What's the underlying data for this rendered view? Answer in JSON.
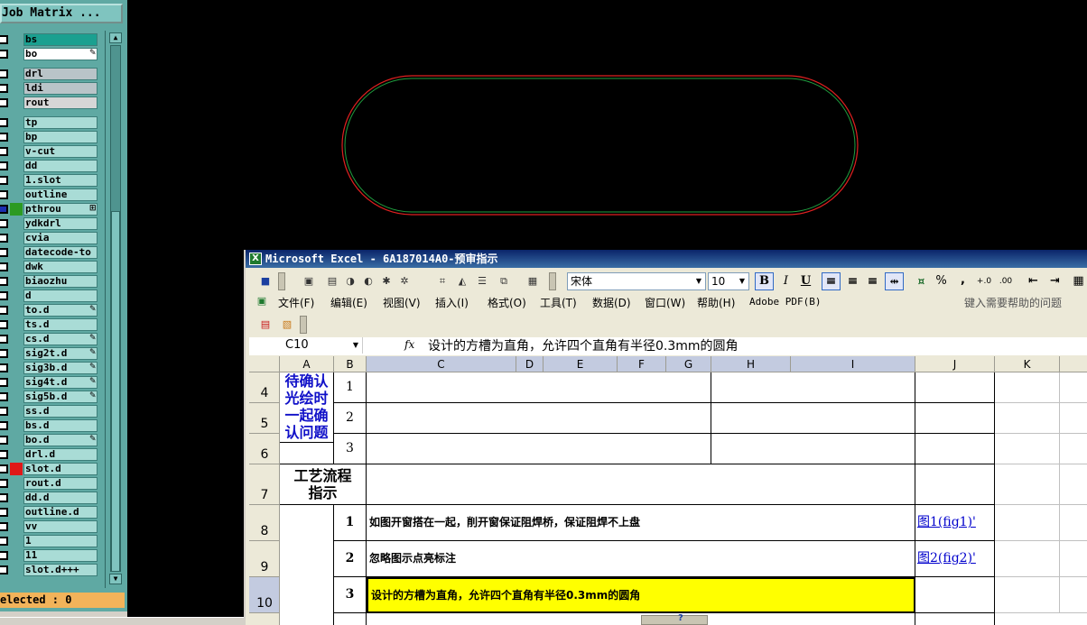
{
  "job_matrix": {
    "title": "Job Matrix ...",
    "layers": [
      {
        "name": "bs",
        "highlight": "#1aa090",
        "swatch": ""
      },
      {
        "name": "bo",
        "highlight": "#ffffff",
        "swatch": "",
        "mark": "✎"
      },
      {
        "name": "drl",
        "highlight": "#b9c4c8",
        "swatch": ""
      },
      {
        "name": "ldi",
        "highlight": "#b9c4c8",
        "swatch": ""
      },
      {
        "name": "rout",
        "highlight": "#d6d6d6",
        "swatch": ""
      },
      {
        "name": "tp",
        "highlight": "",
        "swatch": ""
      },
      {
        "name": "bp",
        "highlight": "",
        "swatch": ""
      },
      {
        "name": "v-cut",
        "highlight": "",
        "swatch": ""
      },
      {
        "name": "dd",
        "highlight": "",
        "swatch": ""
      },
      {
        "name": "1.slot",
        "highlight": "",
        "swatch": ""
      },
      {
        "name": "outline",
        "highlight": "",
        "swatch": ""
      },
      {
        "name": "pthrou",
        "highlight": "",
        "swatch": "#2c9a22",
        "mark": "⊞",
        "chk_color": "#1b2fb0"
      },
      {
        "name": "ydkdrl",
        "highlight": "",
        "swatch": ""
      },
      {
        "name": "cvia",
        "highlight": "",
        "swatch": ""
      },
      {
        "name": "datecode-to",
        "highlight": "",
        "swatch": ""
      },
      {
        "name": "dwk",
        "highlight": "",
        "swatch": ""
      },
      {
        "name": "biaozhu",
        "highlight": "",
        "swatch": ""
      },
      {
        "name": "d",
        "highlight": "",
        "swatch": ""
      },
      {
        "name": "to.d",
        "highlight": "",
        "swatch": "",
        "mark": "✎"
      },
      {
        "name": "ts.d",
        "highlight": "",
        "swatch": ""
      },
      {
        "name": "cs.d",
        "highlight": "",
        "swatch": "",
        "mark": "✎"
      },
      {
        "name": "sig2t.d",
        "highlight": "",
        "swatch": "",
        "mark": "✎"
      },
      {
        "name": "sig3b.d",
        "highlight": "",
        "swatch": "",
        "mark": "✎"
      },
      {
        "name": "sig4t.d",
        "highlight": "",
        "swatch": "",
        "mark": "✎"
      },
      {
        "name": "sig5b.d",
        "highlight": "",
        "swatch": "",
        "mark": "✎"
      },
      {
        "name": "ss.d",
        "highlight": "",
        "swatch": ""
      },
      {
        "name": "bs.d",
        "highlight": "",
        "swatch": ""
      },
      {
        "name": "bo.d",
        "highlight": "",
        "swatch": "",
        "mark": "✎"
      },
      {
        "name": "drl.d",
        "highlight": "",
        "swatch": ""
      },
      {
        "name": "slot.d",
        "highlight": "",
        "swatch": "#e01818"
      },
      {
        "name": "rout.d",
        "highlight": "",
        "swatch": ""
      },
      {
        "name": "dd.d",
        "highlight": "",
        "swatch": ""
      },
      {
        "name": "outline.d",
        "highlight": "",
        "swatch": ""
      },
      {
        "name": "vv",
        "highlight": "",
        "swatch": ""
      },
      {
        "name": "1",
        "highlight": "",
        "swatch": ""
      },
      {
        "name": "11",
        "highlight": "",
        "swatch": ""
      },
      {
        "name": "slot.d+++",
        "highlight": "",
        "swatch": ""
      }
    ],
    "status": "elected : 0"
  },
  "drawing": {
    "outer_color": "#e02020",
    "inner_color": "#20a040"
  },
  "excel": {
    "title": "Microsoft Excel - 6A187014A0-预审指示",
    "font_name": "宋体",
    "font_size": "10",
    "format_buttons": {
      "bold": "B",
      "italic": "I",
      "underline": "U"
    },
    "number_buttons": [
      "%",
      ",",
      "+.0",
      ".00"
    ],
    "menu": [
      "文件(F)",
      "编辑(E)",
      "视图(V)",
      "插入(I)",
      "格式(O)",
      "工具(T)",
      "数据(D)",
      "窗口(W)",
      "帮助(H)",
      "Adobe PDF(B)"
    ],
    "help_placeholder": "键入需要帮助的问题",
    "name_box": "C10",
    "fx": "fx",
    "formula": "设计的方槽为直角，允许四个直角有半径0.3mm的圆角",
    "columns": [
      "A",
      "B",
      "C",
      "D",
      "E",
      "F",
      "G",
      "H",
      "I",
      "J",
      "K"
    ],
    "rows": {
      "r4": "4",
      "r5": "5",
      "r6": "6",
      "r7": "7",
      "r8": "8",
      "r9": "9",
      "r10": "10"
    },
    "confirm_label": "待确认光绘时一起确认问题",
    "confirm_nums": [
      "1",
      "2",
      "3"
    ],
    "process_label": "工艺流程指示",
    "items": [
      {
        "num": "1",
        "text": "如图开窗搭在一起，削开窗保证阻焊桥，保证阻焊不上盘",
        "link": "图1(fig1)'"
      },
      {
        "num": "2",
        "text": "忽略图示点亮标注",
        "link": "图2(fig2)'"
      },
      {
        "num": "3",
        "text": "设计的方槽为直角，允许四个直角有半径0.3mm的圆角",
        "link": ""
      }
    ],
    "highlight_color": "#ffff00"
  }
}
